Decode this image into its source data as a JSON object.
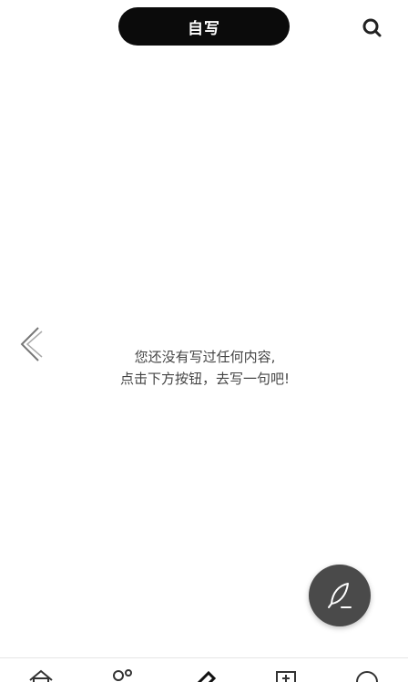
{
  "header": {
    "title": "自写",
    "search_icon": "search-icon"
  },
  "main": {
    "back_icon": "chevron-left-icon",
    "empty_line1": "您还没有写过任何内容,",
    "empty_line2": "点击下方按钮，去写一句吧!"
  },
  "fab": {
    "icon": "feather-pen-icon",
    "background": "#4a4a4a"
  },
  "bottom_nav": {
    "items": [
      {
        "icon": "home-icon"
      },
      {
        "icon": "people-icon"
      },
      {
        "icon": "pen-icon"
      },
      {
        "icon": "add-box-icon"
      },
      {
        "icon": "profile-icon"
      }
    ]
  }
}
